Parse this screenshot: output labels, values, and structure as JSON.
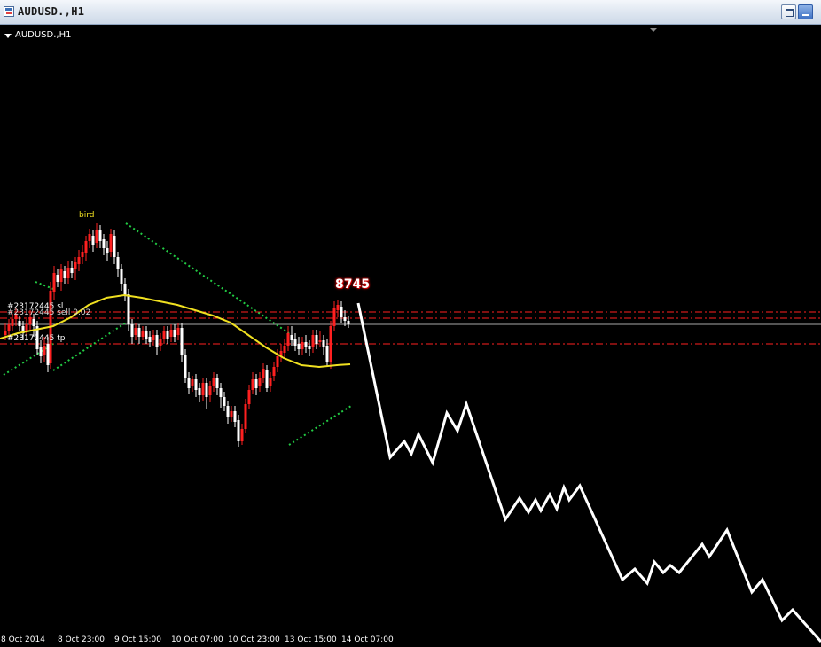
{
  "window": {
    "title": "AUDUSD.,H1",
    "buttons": {
      "restore": "restore-icon",
      "minimize": "minimize-icon"
    }
  },
  "chart": {
    "symbol_label": "AUDUSD.,H1",
    "annotations": {
      "bird": "bird",
      "price_label": "8745",
      "order_1": "#23172445 sl",
      "order_2": "#23172445 sell 0.02",
      "order_3": "#23172445 tp"
    },
    "colors": {
      "background": "#000000",
      "bull_candle": "#ff2020",
      "bear_candle": "#ffffff",
      "moving_average": "#f0e020",
      "channel_dots": "#22cc44",
      "order_lines": "#ff2020",
      "forecast_line": "#ffffff"
    },
    "x_ticks": [
      "8 Oct 2014",
      "8 Oct 23:00",
      "9 Oct 15:00",
      "10 Oct 07:00",
      "10 Oct 23:00",
      "13 Oct 15:00",
      "14 Oct 07:00"
    ]
  }
}
